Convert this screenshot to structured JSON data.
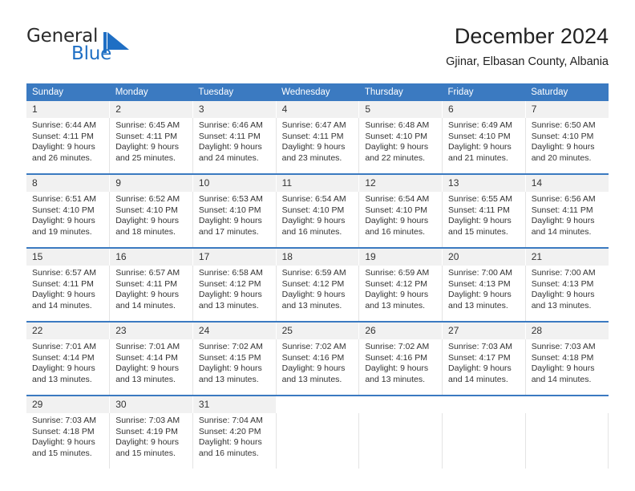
{
  "brand": {
    "name_part1": "General",
    "name_part2": "Blue",
    "mark": "triangle-flag-icon",
    "accent_color": "#1f6fc4"
  },
  "header": {
    "title": "December 2024",
    "subtitle": "Gjinar, Elbasan County, Albania"
  },
  "theme": {
    "header_blue": "#3b7ac1",
    "daynum_bg": "#f1f1f1",
    "text": "#333333"
  },
  "weekday_headers": [
    "Sunday",
    "Monday",
    "Tuesday",
    "Wednesday",
    "Thursday",
    "Friday",
    "Saturday"
  ],
  "weeks": [
    {
      "days": [
        {
          "num": "1",
          "sunrise": "Sunrise: 6:44 AM",
          "sunset": "Sunset: 4:11 PM",
          "daylight1": "Daylight: 9 hours",
          "daylight2": "and 26 minutes."
        },
        {
          "num": "2",
          "sunrise": "Sunrise: 6:45 AM",
          "sunset": "Sunset: 4:11 PM",
          "daylight1": "Daylight: 9 hours",
          "daylight2": "and 25 minutes."
        },
        {
          "num": "3",
          "sunrise": "Sunrise: 6:46 AM",
          "sunset": "Sunset: 4:11 PM",
          "daylight1": "Daylight: 9 hours",
          "daylight2": "and 24 minutes."
        },
        {
          "num": "4",
          "sunrise": "Sunrise: 6:47 AM",
          "sunset": "Sunset: 4:11 PM",
          "daylight1": "Daylight: 9 hours",
          "daylight2": "and 23 minutes."
        },
        {
          "num": "5",
          "sunrise": "Sunrise: 6:48 AM",
          "sunset": "Sunset: 4:10 PM",
          "daylight1": "Daylight: 9 hours",
          "daylight2": "and 22 minutes."
        },
        {
          "num": "6",
          "sunrise": "Sunrise: 6:49 AM",
          "sunset": "Sunset: 4:10 PM",
          "daylight1": "Daylight: 9 hours",
          "daylight2": "and 21 minutes."
        },
        {
          "num": "7",
          "sunrise": "Sunrise: 6:50 AM",
          "sunset": "Sunset: 4:10 PM",
          "daylight1": "Daylight: 9 hours",
          "daylight2": "and 20 minutes."
        }
      ]
    },
    {
      "days": [
        {
          "num": "8",
          "sunrise": "Sunrise: 6:51 AM",
          "sunset": "Sunset: 4:10 PM",
          "daylight1": "Daylight: 9 hours",
          "daylight2": "and 19 minutes."
        },
        {
          "num": "9",
          "sunrise": "Sunrise: 6:52 AM",
          "sunset": "Sunset: 4:10 PM",
          "daylight1": "Daylight: 9 hours",
          "daylight2": "and 18 minutes."
        },
        {
          "num": "10",
          "sunrise": "Sunrise: 6:53 AM",
          "sunset": "Sunset: 4:10 PM",
          "daylight1": "Daylight: 9 hours",
          "daylight2": "and 17 minutes."
        },
        {
          "num": "11",
          "sunrise": "Sunrise: 6:54 AM",
          "sunset": "Sunset: 4:10 PM",
          "daylight1": "Daylight: 9 hours",
          "daylight2": "and 16 minutes."
        },
        {
          "num": "12",
          "sunrise": "Sunrise: 6:54 AM",
          "sunset": "Sunset: 4:10 PM",
          "daylight1": "Daylight: 9 hours",
          "daylight2": "and 16 minutes."
        },
        {
          "num": "13",
          "sunrise": "Sunrise: 6:55 AM",
          "sunset": "Sunset: 4:11 PM",
          "daylight1": "Daylight: 9 hours",
          "daylight2": "and 15 minutes."
        },
        {
          "num": "14",
          "sunrise": "Sunrise: 6:56 AM",
          "sunset": "Sunset: 4:11 PM",
          "daylight1": "Daylight: 9 hours",
          "daylight2": "and 14 minutes."
        }
      ]
    },
    {
      "days": [
        {
          "num": "15",
          "sunrise": "Sunrise: 6:57 AM",
          "sunset": "Sunset: 4:11 PM",
          "daylight1": "Daylight: 9 hours",
          "daylight2": "and 14 minutes."
        },
        {
          "num": "16",
          "sunrise": "Sunrise: 6:57 AM",
          "sunset": "Sunset: 4:11 PM",
          "daylight1": "Daylight: 9 hours",
          "daylight2": "and 14 minutes."
        },
        {
          "num": "17",
          "sunrise": "Sunrise: 6:58 AM",
          "sunset": "Sunset: 4:12 PM",
          "daylight1": "Daylight: 9 hours",
          "daylight2": "and 13 minutes."
        },
        {
          "num": "18",
          "sunrise": "Sunrise: 6:59 AM",
          "sunset": "Sunset: 4:12 PM",
          "daylight1": "Daylight: 9 hours",
          "daylight2": "and 13 minutes."
        },
        {
          "num": "19",
          "sunrise": "Sunrise: 6:59 AM",
          "sunset": "Sunset: 4:12 PM",
          "daylight1": "Daylight: 9 hours",
          "daylight2": "and 13 minutes."
        },
        {
          "num": "20",
          "sunrise": "Sunrise: 7:00 AM",
          "sunset": "Sunset: 4:13 PM",
          "daylight1": "Daylight: 9 hours",
          "daylight2": "and 13 minutes."
        },
        {
          "num": "21",
          "sunrise": "Sunrise: 7:00 AM",
          "sunset": "Sunset: 4:13 PM",
          "daylight1": "Daylight: 9 hours",
          "daylight2": "and 13 minutes."
        }
      ]
    },
    {
      "days": [
        {
          "num": "22",
          "sunrise": "Sunrise: 7:01 AM",
          "sunset": "Sunset: 4:14 PM",
          "daylight1": "Daylight: 9 hours",
          "daylight2": "and 13 minutes."
        },
        {
          "num": "23",
          "sunrise": "Sunrise: 7:01 AM",
          "sunset": "Sunset: 4:14 PM",
          "daylight1": "Daylight: 9 hours",
          "daylight2": "and 13 minutes."
        },
        {
          "num": "24",
          "sunrise": "Sunrise: 7:02 AM",
          "sunset": "Sunset: 4:15 PM",
          "daylight1": "Daylight: 9 hours",
          "daylight2": "and 13 minutes."
        },
        {
          "num": "25",
          "sunrise": "Sunrise: 7:02 AM",
          "sunset": "Sunset: 4:16 PM",
          "daylight1": "Daylight: 9 hours",
          "daylight2": "and 13 minutes."
        },
        {
          "num": "26",
          "sunrise": "Sunrise: 7:02 AM",
          "sunset": "Sunset: 4:16 PM",
          "daylight1": "Daylight: 9 hours",
          "daylight2": "and 13 minutes."
        },
        {
          "num": "27",
          "sunrise": "Sunrise: 7:03 AM",
          "sunset": "Sunset: 4:17 PM",
          "daylight1": "Daylight: 9 hours",
          "daylight2": "and 14 minutes."
        },
        {
          "num": "28",
          "sunrise": "Sunrise: 7:03 AM",
          "sunset": "Sunset: 4:18 PM",
          "daylight1": "Daylight: 9 hours",
          "daylight2": "and 14 minutes."
        }
      ]
    },
    {
      "days": [
        {
          "num": "29",
          "sunrise": "Sunrise: 7:03 AM",
          "sunset": "Sunset: 4:18 PM",
          "daylight1": "Daylight: 9 hours",
          "daylight2": "and 15 minutes."
        },
        {
          "num": "30",
          "sunrise": "Sunrise: 7:03 AM",
          "sunset": "Sunset: 4:19 PM",
          "daylight1": "Daylight: 9 hours",
          "daylight2": "and 15 minutes."
        },
        {
          "num": "31",
          "sunrise": "Sunrise: 7:04 AM",
          "sunset": "Sunset: 4:20 PM",
          "daylight1": "Daylight: 9 hours",
          "daylight2": "and 16 minutes."
        },
        {
          "num": "",
          "sunrise": "",
          "sunset": "",
          "daylight1": "",
          "daylight2": ""
        },
        {
          "num": "",
          "sunrise": "",
          "sunset": "",
          "daylight1": "",
          "daylight2": ""
        },
        {
          "num": "",
          "sunrise": "",
          "sunset": "",
          "daylight1": "",
          "daylight2": ""
        },
        {
          "num": "",
          "sunrise": "",
          "sunset": "",
          "daylight1": "",
          "daylight2": ""
        }
      ]
    }
  ]
}
